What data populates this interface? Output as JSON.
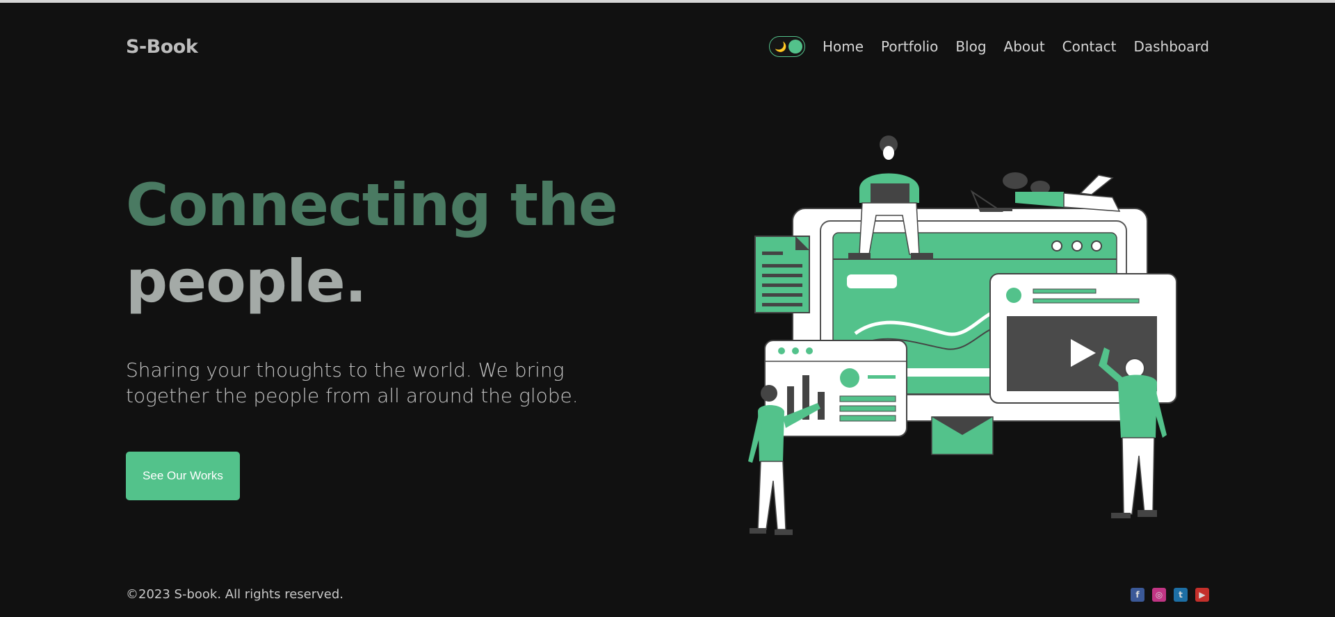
{
  "brand": {
    "name": "S-Book"
  },
  "nav": {
    "links": [
      "Home",
      "Portfolio",
      "Blog",
      "About",
      "Contact",
      "Dashboard"
    ],
    "theme_toggle": {
      "icon": "moon-icon",
      "glyph": "🌙",
      "state": "dark"
    }
  },
  "hero": {
    "title_line1": "Connecting the",
    "title_line2": "people.",
    "description": "Sharing your thoughts to the world. We bring together the people from all around the globe.",
    "cta_label": "See Our Works",
    "illustration": "people-connecting-illustration"
  },
  "footer": {
    "copyright": "©2023 S-book. All rights reserved.",
    "social": [
      {
        "name": "facebook-icon",
        "glyph": "f",
        "color": "#3b5998"
      },
      {
        "name": "instagram-icon",
        "glyph": "◎",
        "color": "#c13584"
      },
      {
        "name": "twitter-icon",
        "glyph": "t",
        "color": "#1d6fa5"
      },
      {
        "name": "youtube-icon",
        "glyph": "▶",
        "color": "#c4302b"
      }
    ]
  },
  "colors": {
    "background": "#111111",
    "accent": "#53c28b",
    "title_green": "#4a7a62",
    "title_grey": "#a4aaa7"
  }
}
